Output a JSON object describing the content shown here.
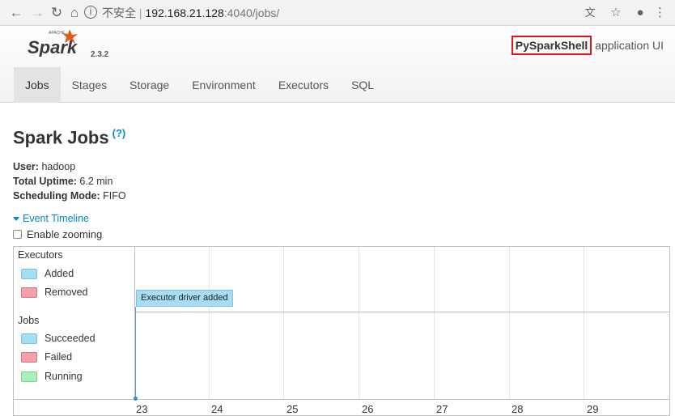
{
  "browser": {
    "insecure_label": "不安全",
    "separator": "|",
    "host": "192.168.21.128",
    "port_path": ":4040/jobs/",
    "icons": [
      "back-icon",
      "forward-icon",
      "reload-icon",
      "home-icon",
      "info-icon",
      "translate-icon",
      "star-icon",
      "account-icon",
      "menu-icon"
    ]
  },
  "header": {
    "logo_text": "Spark",
    "logo_apache": "APACHE",
    "version": "2.3.2",
    "app_name": "PySparkShell",
    "app_suffix": " application UI",
    "tabs": [
      {
        "label": "Jobs",
        "active": true
      },
      {
        "label": "Stages"
      },
      {
        "label": "Storage"
      },
      {
        "label": "Environment"
      },
      {
        "label": "Executors"
      },
      {
        "label": "SQL"
      }
    ]
  },
  "main": {
    "title": "Spark Jobs",
    "help": "(?)",
    "user_label": "User:",
    "user_value": " hadoop",
    "uptime_label": "Total Uptime:",
    "uptime_value": " 6.2 min",
    "mode_label": "Scheduling Mode:",
    "mode_value": " FIFO",
    "timeline_toggle": "Event Timeline",
    "zoom_label": "Enable zooming"
  },
  "timeline": {
    "executors_title": "Executors",
    "executors_legend": [
      "Added",
      "Removed"
    ],
    "jobs_title": "Jobs",
    "jobs_legend": [
      "Succeeded",
      "Failed",
      "Running"
    ],
    "event": "Executor driver added",
    "axis_labels": [
      "23",
      "24",
      "25",
      "26",
      "27",
      "28",
      "29"
    ],
    "colors": {
      "added": "#a6ddf5",
      "removed": "#f4a1ab",
      "running": "#a9f0b8"
    }
  }
}
